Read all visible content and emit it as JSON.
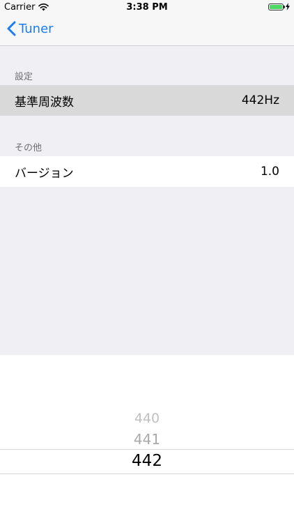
{
  "status_bar": {
    "carrier": "Carrier",
    "time": "3:38 PM",
    "icons": {
      "wifi": "wifi-icon",
      "battery": "battery-icon",
      "charging": "bolt-icon"
    },
    "battery_color": "#4cd964"
  },
  "nav": {
    "back_label": "Tuner",
    "back_icon": "chevron-left-icon",
    "accent": "#1a7cf3"
  },
  "sections": {
    "settings": {
      "header": "設定",
      "rows": [
        {
          "label": "基準周波数",
          "value": "442Hz"
        }
      ]
    },
    "other": {
      "header": "その他",
      "rows": [
        {
          "label": "バージョン",
          "value": "1.0"
        }
      ]
    }
  },
  "picker": {
    "items": [
      "440",
      "441",
      "442"
    ],
    "selected": "442"
  }
}
